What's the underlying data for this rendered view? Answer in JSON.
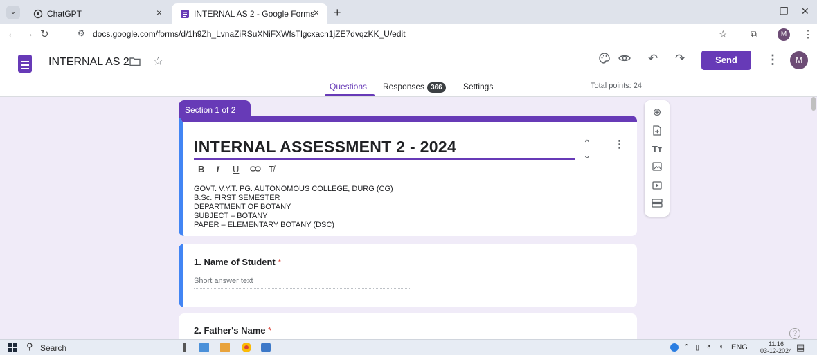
{
  "browser": {
    "tabs": [
      {
        "title": "ChatGPT"
      },
      {
        "title": "INTERNAL AS 2 - Google Forms"
      }
    ],
    "url": "docs.google.com/forms/d/1h9Zh_LvnaZiRSuXNiFXWfsTlgcxacn1jZE7dvqzKK_U/edit",
    "profile_initial": "M"
  },
  "header": {
    "form_name": "INTERNAL AS 2",
    "send_label": "Send",
    "avatar_initial": "M",
    "tabs": {
      "questions": "Questions",
      "responses": "Responses",
      "responses_count": "366",
      "settings": "Settings"
    },
    "total_points": "Total points: 24"
  },
  "section": {
    "label": "Section 1 of 2",
    "title": "INTERNAL ASSESSMENT 2 - 2024",
    "description": [
      "GOVT. V.Y.T. PG. AUTONOMOUS COLLEGE, DURG (CG)",
      "B.Sc. FIRST SEMESTER",
      "DEPARTMENT OF BOTANY",
      "SUBJECT – BOTANY",
      "PAPER – ELEMENTARY BOTANY  (DSC)"
    ]
  },
  "questions": [
    {
      "title": "1. Name of Student",
      "required_mark": "*",
      "placeholder": "Short answer text"
    },
    {
      "title": "2. Father's Name",
      "required_mark": "*"
    }
  ],
  "taskbar": {
    "search_label": "Search",
    "language": "ENG",
    "time": "11:16",
    "date": "03-12-2024"
  },
  "colors": {
    "accent": "#673ab7",
    "active_edge": "#4285f4",
    "background": "#f0ebf8"
  }
}
